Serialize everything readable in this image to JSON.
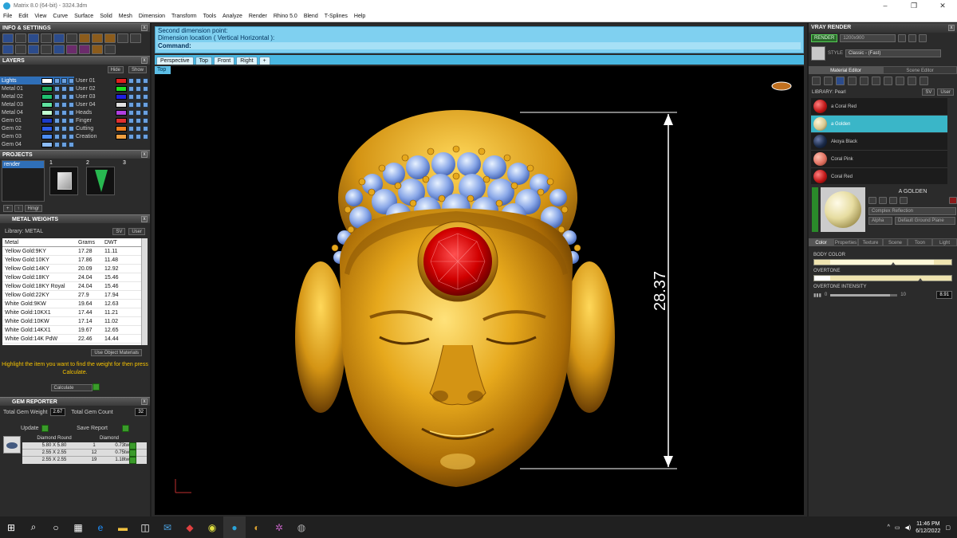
{
  "window": {
    "title": "Matrix 8.0 (64-bit) - 3324.3dm"
  },
  "menu": [
    "File",
    "Edit",
    "View",
    "Curve",
    "Surface",
    "Solid",
    "Mesh",
    "Dimension",
    "Transform",
    "Tools",
    "Analyze",
    "Render",
    "Rhino 5.0",
    "Blend",
    "T-Splines",
    "Help"
  ],
  "left": {
    "info_title": "INFO & SETTINGS",
    "layers_title": "LAYERS",
    "layers_hide": "Hide",
    "layers_show": "Show",
    "layers_left": [
      {
        "name": "Lights",
        "color": "#ffffff"
      },
      {
        "name": "Metal 01",
        "color": "#1aa85a"
      },
      {
        "name": "Metal 02",
        "color": "#20c070"
      },
      {
        "name": "Metal 03",
        "color": "#60e0a0"
      },
      {
        "name": "Metal 04",
        "color": "#c0ffd0"
      },
      {
        "name": "Gem 01",
        "color": "#1c3cc8"
      },
      {
        "name": "Gem 02",
        "color": "#2c5ce8"
      },
      {
        "name": "Gem 03",
        "color": "#4c8cf0"
      },
      {
        "name": "Gem 04",
        "color": "#8cbcf8"
      }
    ],
    "layers_right": [
      {
        "name": "User 01",
        "color": "#e02020"
      },
      {
        "name": "User 02",
        "color": "#20e020"
      },
      {
        "name": "User 03",
        "color": "#2020e0"
      },
      {
        "name": "User 04",
        "color": "#e0e0e0"
      },
      {
        "name": "Heads",
        "color": "#b040e0"
      },
      {
        "name": "Finger",
        "color": "#e03030"
      },
      {
        "name": "Cutting",
        "color": "#f08020"
      },
      {
        "name": "Creation",
        "color": "#f0a040"
      }
    ],
    "projects_title": "PROJECTS",
    "project_item": "render",
    "project_nums": [
      "1",
      "2",
      "3"
    ],
    "hmgr": "Hmgr",
    "metal_title": "METAL WEIGHTS",
    "library_label": "Library: METAL",
    "sv": "SV",
    "user": "User",
    "metal_headers": [
      "Metal",
      "Grams",
      "DWT"
    ],
    "metals": [
      [
        "Yellow Gold:9KY",
        "17.28",
        "11.11"
      ],
      [
        "Yellow Gold:10KY",
        "17.86",
        "11.48"
      ],
      [
        "Yellow Gold:14KY",
        "20.09",
        "12.92"
      ],
      [
        "Yellow Gold:18KY",
        "24.04",
        "15.46"
      ],
      [
        "Yellow Gold:18KY Royal",
        "24.04",
        "15.46"
      ],
      [
        "Yellow Gold:22KY",
        "27.9",
        "17.94"
      ],
      [
        "White Gold:9KW",
        "19.64",
        "12.63"
      ],
      [
        "White Gold:10KX1",
        "17.44",
        "11.21"
      ],
      [
        "White Gold:10KW",
        "17.14",
        "11.02"
      ],
      [
        "White Gold:14KX1",
        "19.67",
        "12.65"
      ],
      [
        "White Gold:14K PdW",
        "22.46",
        "14.44"
      ]
    ],
    "use_obj_materials": "Use Object Materials",
    "hint": "Highlight the item you want to find the weight for then press Calculate.",
    "calculate": "Calculate",
    "gem_title": "GEM REPORTER",
    "total_weight_label": "Total Gem Weight",
    "total_weight": "2.67",
    "total_count_label": "Total Gem Count",
    "total_count": "32",
    "update": "Update",
    "save_report": "Save Report",
    "gem_headers": [
      "Diamond Round",
      "Diamond"
    ],
    "gems": [
      [
        "5.80 X 5.80",
        "1",
        "0.73tw"
      ],
      [
        "2.55 X 2.55",
        "12",
        "0.75tw"
      ],
      [
        "2.55 X 2.55",
        "19",
        "1.18tw"
      ]
    ]
  },
  "command": {
    "line1": "Second dimension point:",
    "line2": "Dimension location ( Vertical  Horizontal ):",
    "line3": "Command:"
  },
  "tabs": [
    "Perspective",
    "Top",
    "Front",
    "Right",
    "+"
  ],
  "viewport_label": "Top",
  "dimension": "28.37",
  "right": {
    "title": "VRAY RENDER",
    "render": "RENDER",
    "resolution": "1200x900",
    "style_label": "STYLE",
    "style_value": "Classic - (Fast)",
    "material_editor": "Material Editor",
    "scene_editor": "Scene Editor",
    "library_label": "LIBRARY: Pearl",
    "materials": [
      {
        "name": "a Coral Red",
        "color": "#c01818"
      },
      {
        "name": "a Golden",
        "color": "#d8c890"
      },
      {
        "name": "Akoya Black",
        "color": "#1a2a48"
      },
      {
        "name": "Coral Pink",
        "color": "#e07060"
      },
      {
        "name": "Coral Red",
        "color": "#c01818"
      }
    ],
    "preview_name": "A GOLDEN",
    "complex": "Complex Reflection",
    "alpha": "Alpha",
    "ground": "Default Ground Plane",
    "prop_tabs": [
      "Color",
      "Properties",
      "Texture",
      "Scene",
      "Toon",
      "Light"
    ],
    "body_color": "BODY COLOR",
    "overtone": "OVERTONE",
    "overtone_intensity": "OVERTONE INTENSITY",
    "intensity_min": "0",
    "intensity_max": "10",
    "intensity_value": "8.91"
  },
  "taskbar": {
    "time": "11:46 PM",
    "date": "6/12/2022"
  }
}
